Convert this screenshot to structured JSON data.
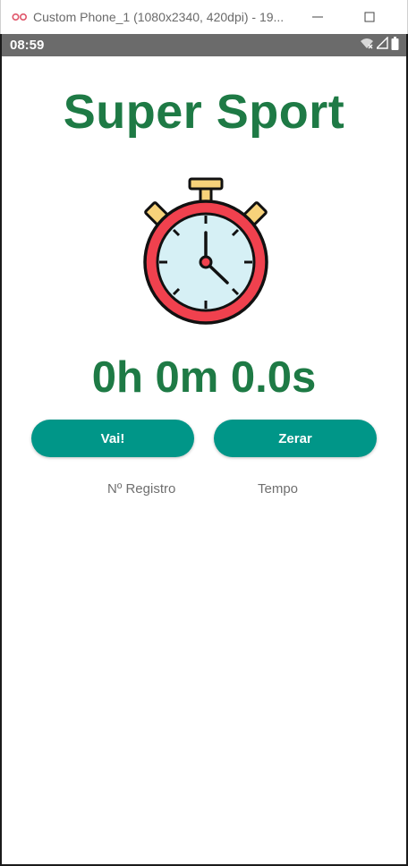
{
  "window": {
    "title": "Custom Phone_1 (1080x2340, 420dpi) - 19...",
    "icon": "emulator-icon",
    "controls": [
      "minimize-icon",
      "maximize-icon"
    ]
  },
  "statusbar": {
    "time": "08:59",
    "icons": [
      "wifi-icon",
      "signal-icon",
      "battery-icon"
    ]
  },
  "app": {
    "title": "Super Sport",
    "timer_display": "0h 0m 0.0s",
    "start_button": "Vai!",
    "reset_button": "Zerar",
    "table_headers": [
      "Nº Registro",
      "Tempo"
    ],
    "colors": {
      "title": "#1e7a45",
      "button": "#009688",
      "stopwatch_body": "#f0414e",
      "stopwatch_face": "#d6f0f5",
      "stopwatch_knob": "#f7d27a"
    }
  }
}
